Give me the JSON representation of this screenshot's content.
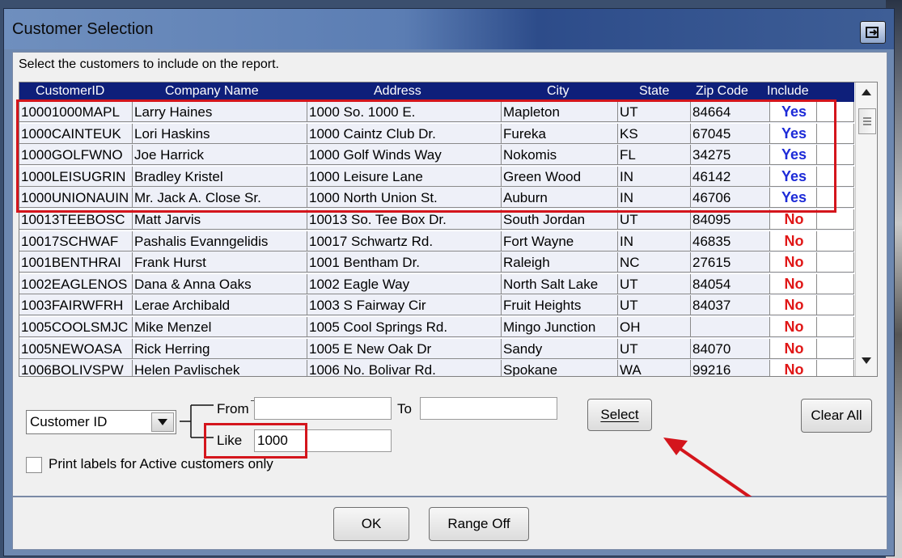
{
  "window": {
    "title": "Customer Selection"
  },
  "instruction": "Select the customers to include on the report.",
  "table": {
    "columns": [
      "CustomerID",
      "Company Name",
      "Address",
      "City",
      "State",
      "Zip Code",
      "Include"
    ],
    "rows": [
      [
        "10001000MAPL",
        "Larry Haines",
        "1000 So. 1000 E.",
        "Mapleton",
        "UT",
        "84664",
        "Yes"
      ],
      [
        "1000CAINTEUK",
        "Lori Haskins",
        "1000 Caintz Club Dr.",
        "Fureka",
        "KS",
        "67045",
        "Yes"
      ],
      [
        "1000GOLFWNO",
        "Joe Harrick",
        "1000 Golf Winds Way",
        "Nokomis",
        "FL",
        "34275",
        "Yes"
      ],
      [
        "1000LEISUGRIN",
        "Bradley Kristel",
        "1000 Leisure Lane",
        "Green Wood",
        "IN",
        "46142",
        "Yes"
      ],
      [
        "1000UNIONAUIN",
        "Mr. Jack A. Close Sr.",
        "1000 North Union St.",
        "Auburn",
        "IN",
        "46706",
        "Yes"
      ],
      [
        "10013TEEBOSC",
        "Matt Jarvis",
        "10013 So. Tee Box Dr.",
        "South Jordan",
        "UT",
        "84095",
        "No"
      ],
      [
        "10017SCHWAF",
        "Pashalis Evanngelidis",
        "10017 Schwartz Rd.",
        "Fort Wayne",
        "IN",
        "46835",
        "No"
      ],
      [
        "1001BENTHRAI",
        "Frank Hurst",
        "1001 Bentham Dr.",
        "Raleigh",
        "NC",
        "27615",
        "No"
      ],
      [
        "1002EAGLENOS",
        "Dana & Anna Oaks",
        "1002 Eagle Way",
        "North Salt Lake",
        "UT",
        "84054",
        "No"
      ],
      [
        "1003FAIRWFRH",
        "Lerae Archibald",
        "1003 S Fairway Cir",
        "Fruit Heights",
        "UT",
        "84037",
        "No"
      ],
      [
        "1005COOLSMJC",
        "Mike Menzel",
        "1005 Cool Springs Rd.",
        "Mingo Junction",
        "OH",
        "",
        "No"
      ],
      [
        "1005NEWOASA",
        "Rick Herring",
        "1005 E New Oak Dr",
        "Sandy",
        "UT",
        "84070",
        "No"
      ],
      [
        "1006BOLIVSPW",
        "Helen Pavlischek",
        "1006 No. Bolivar Rd.",
        "Spokane",
        "WA",
        "99216",
        "No"
      ]
    ]
  },
  "filter": {
    "field_select": "Customer ID",
    "from_label": "From",
    "to_label": "To",
    "like_label": "Like",
    "from_value": "",
    "to_value": "",
    "like_value": "1000"
  },
  "buttons": {
    "select": "Select",
    "clear_all": "Clear All",
    "ok": "OK",
    "range_off": "Range Off"
  },
  "checkbox": {
    "label": "Print labels for Active customers only",
    "checked": false
  },
  "colors": {
    "header_bg": "#0e1f7a",
    "yes": "#1d2bd8",
    "no": "#e01616",
    "highlight": "#d4151c"
  }
}
